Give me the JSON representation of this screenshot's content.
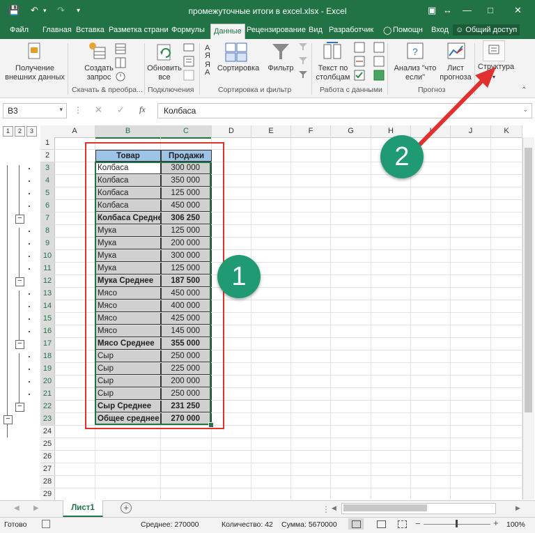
{
  "window": {
    "title": "промежуточные итоги в excel.xlsx - Excel"
  },
  "ribbon_tabs": [
    {
      "label": "Файл"
    },
    {
      "label": "Главная"
    },
    {
      "label": "Вставка"
    },
    {
      "label": "Разметка страни"
    },
    {
      "label": "Формулы"
    },
    {
      "label": "Данные"
    },
    {
      "label": "Рецензирование"
    },
    {
      "label": "Вид"
    },
    {
      "label": "Разработчик"
    },
    {
      "label": "Помощн"
    },
    {
      "label": "Вход"
    },
    {
      "label": "Общий доступ"
    }
  ],
  "active_tab": "Данные",
  "ribbon": {
    "get_external": [
      "Получение",
      "внешних данных"
    ],
    "create_query": [
      "Создать",
      "запрос"
    ],
    "refresh_all": [
      "Обновить",
      "все"
    ],
    "sort": "Сортировка",
    "filter": "Фильтр",
    "text_to_columns": [
      "Текст по",
      "столбцам"
    ],
    "what_if": [
      "Анализ \"что",
      "если\""
    ],
    "forecast_sheet": [
      "Лист",
      "прогноза"
    ],
    "outline": "Структура",
    "groups": [
      "Скачать & преобра...",
      "Подключения",
      "Сортировка и фильтр",
      "Работа с данными",
      "Прогноз"
    ]
  },
  "formula_bar": {
    "name_box": "B3",
    "fx": "fx",
    "value": "Колбаса"
  },
  "grid": {
    "columns": [
      "A",
      "B",
      "C",
      "D",
      "E",
      "F",
      "G",
      "H",
      "I",
      "J",
      "K"
    ],
    "rows": [
      "1",
      "2",
      "3",
      "4",
      "5",
      "6",
      "7",
      "8",
      "9",
      "10",
      "11",
      "12",
      "13",
      "14",
      "15",
      "16",
      "17",
      "18",
      "19",
      "20",
      "21",
      "22",
      "23",
      "24",
      "25",
      "26",
      "27",
      "28",
      "29"
    ],
    "outline_levels": [
      "1",
      "2",
      "3"
    ],
    "header": {
      "product": "Товар",
      "sales": "Продажи"
    },
    "data": [
      {
        "product": "Колбаса",
        "sales": "300 000",
        "subtotal": false
      },
      {
        "product": "Колбаса",
        "sales": "350 000",
        "subtotal": false
      },
      {
        "product": "Колбаса",
        "sales": "125 000",
        "subtotal": false
      },
      {
        "product": "Колбаса",
        "sales": "450 000",
        "subtotal": false
      },
      {
        "product": "Колбаса Среднее",
        "sales": "306 250",
        "subtotal": true
      },
      {
        "product": "Мука",
        "sales": "125 000",
        "subtotal": false
      },
      {
        "product": "Мука",
        "sales": "200 000",
        "subtotal": false
      },
      {
        "product": "Мука",
        "sales": "300 000",
        "subtotal": false
      },
      {
        "product": "Мука",
        "sales": "125 000",
        "subtotal": false
      },
      {
        "product": "Мука Среднее",
        "sales": "187 500",
        "subtotal": true
      },
      {
        "product": "Мясо",
        "sales": "450 000",
        "subtotal": false
      },
      {
        "product": "Мясо",
        "sales": "400 000",
        "subtotal": false
      },
      {
        "product": "Мясо",
        "sales": "425 000",
        "subtotal": false
      },
      {
        "product": "Мясо",
        "sales": "145 000",
        "subtotal": false
      },
      {
        "product": "Мясо Среднее",
        "sales": "355 000",
        "subtotal": true
      },
      {
        "product": "Сыр",
        "sales": "250 000",
        "subtotal": false
      },
      {
        "product": "Сыр",
        "sales": "225 000",
        "subtotal": false
      },
      {
        "product": "Сыр",
        "sales": "200 000",
        "subtotal": false
      },
      {
        "product": "Сыр",
        "sales": "250 000",
        "subtotal": false
      },
      {
        "product": "Сыр Среднее",
        "sales": "231 250",
        "subtotal": true
      },
      {
        "product": "Общее среднее",
        "sales": "270 000",
        "subtotal": true
      }
    ]
  },
  "annotations": {
    "badge1": "1",
    "badge2": "2"
  },
  "sheet_tabs": [
    {
      "label": "Лист1"
    }
  ],
  "status": {
    "ready": "Готово",
    "average": "Среднее: 270000",
    "count": "Количество: 42",
    "sum": "Сумма: 5670000",
    "zoom": "100%"
  },
  "colors": {
    "excel_green": "#217346",
    "selection_fill": "#d0d0d0",
    "header_fill": "#9dc3e6",
    "annotation_red": "#e0312e",
    "badge_green": "#1f9a73"
  }
}
